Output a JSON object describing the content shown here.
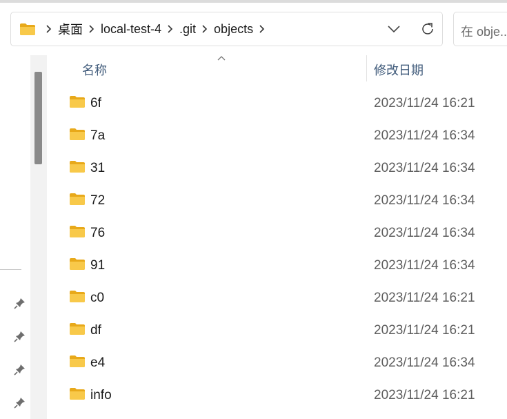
{
  "address_bar": {
    "breadcrumbs": [
      "桌面",
      "local-test-4",
      ".git",
      "objects"
    ]
  },
  "search": {
    "placeholder": "在 obje..."
  },
  "columns": {
    "name": "名称",
    "date_modified": "修改日期"
  },
  "files": [
    {
      "name": "6f",
      "date": "2023/11/24 16:21"
    },
    {
      "name": "7a",
      "date": "2023/11/24 16:34"
    },
    {
      "name": "31",
      "date": "2023/11/24 16:34"
    },
    {
      "name": "72",
      "date": "2023/11/24 16:34"
    },
    {
      "name": "76",
      "date": "2023/11/24 16:34"
    },
    {
      "name": "91",
      "date": "2023/11/24 16:34"
    },
    {
      "name": "c0",
      "date": "2023/11/24 16:21"
    },
    {
      "name": "df",
      "date": "2023/11/24 16:21"
    },
    {
      "name": "e4",
      "date": "2023/11/24 16:34"
    },
    {
      "name": "info",
      "date": "2023/11/24 16:21"
    }
  ],
  "icons": {
    "folder": "folder-icon",
    "chevron": "chevron-right-icon",
    "dropdown": "chevron-down-icon",
    "refresh": "refresh-icon",
    "pin": "pin-icon"
  },
  "colors": {
    "folder_yellow": "#f8c94a",
    "header_text": "#3f5a7a"
  }
}
